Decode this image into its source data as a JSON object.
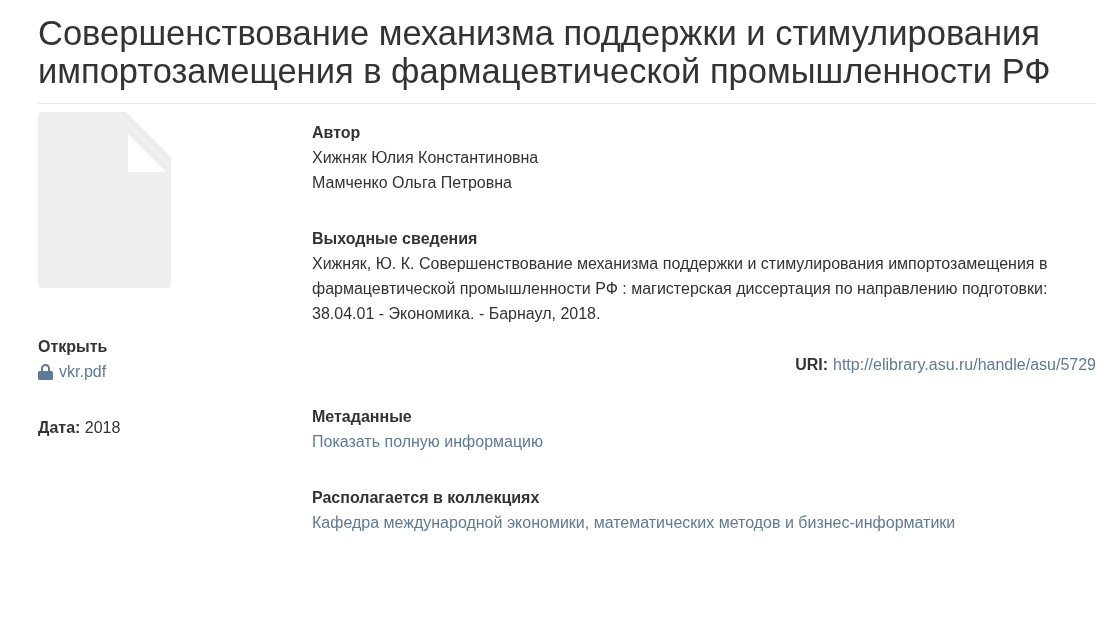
{
  "title": "Совершенствование механизма поддержки и стимулирования импортозамещения в фармацевтической промышленности РФ",
  "files": {
    "heading": "Открыть",
    "items": [
      {
        "name": "vkr.pdf",
        "locked": true
      }
    ]
  },
  "date": {
    "label": "Дата:",
    "value": "2018"
  },
  "sections": [
    {
      "kind": "list",
      "heading": "Автор",
      "items": [
        "Хижняк Юлия Константиновна",
        "Мамченко Ольга Петровна"
      ]
    },
    {
      "kind": "text",
      "heading": "Выходные сведения",
      "text": "Хижняк, Ю. К. Совершенствование механизма поддержки и стимулирования импортозамещения в фармацевтической промышленности РФ : магистерская диссертация по направлению подготовки: 38.04.01 - Экономика. - Барнаул, 2018."
    },
    {
      "kind": "uri",
      "label": "URI:",
      "value": "http://elibrary.asu.ru/handle/asu/5729"
    },
    {
      "kind": "link",
      "heading": "Метаданные",
      "link": "Показать полную информацию"
    },
    {
      "kind": "link",
      "heading": "Располагается в коллекциях",
      "link": "Кафедра международной экономики, математических методов и бизнес-информатики"
    }
  ]
}
